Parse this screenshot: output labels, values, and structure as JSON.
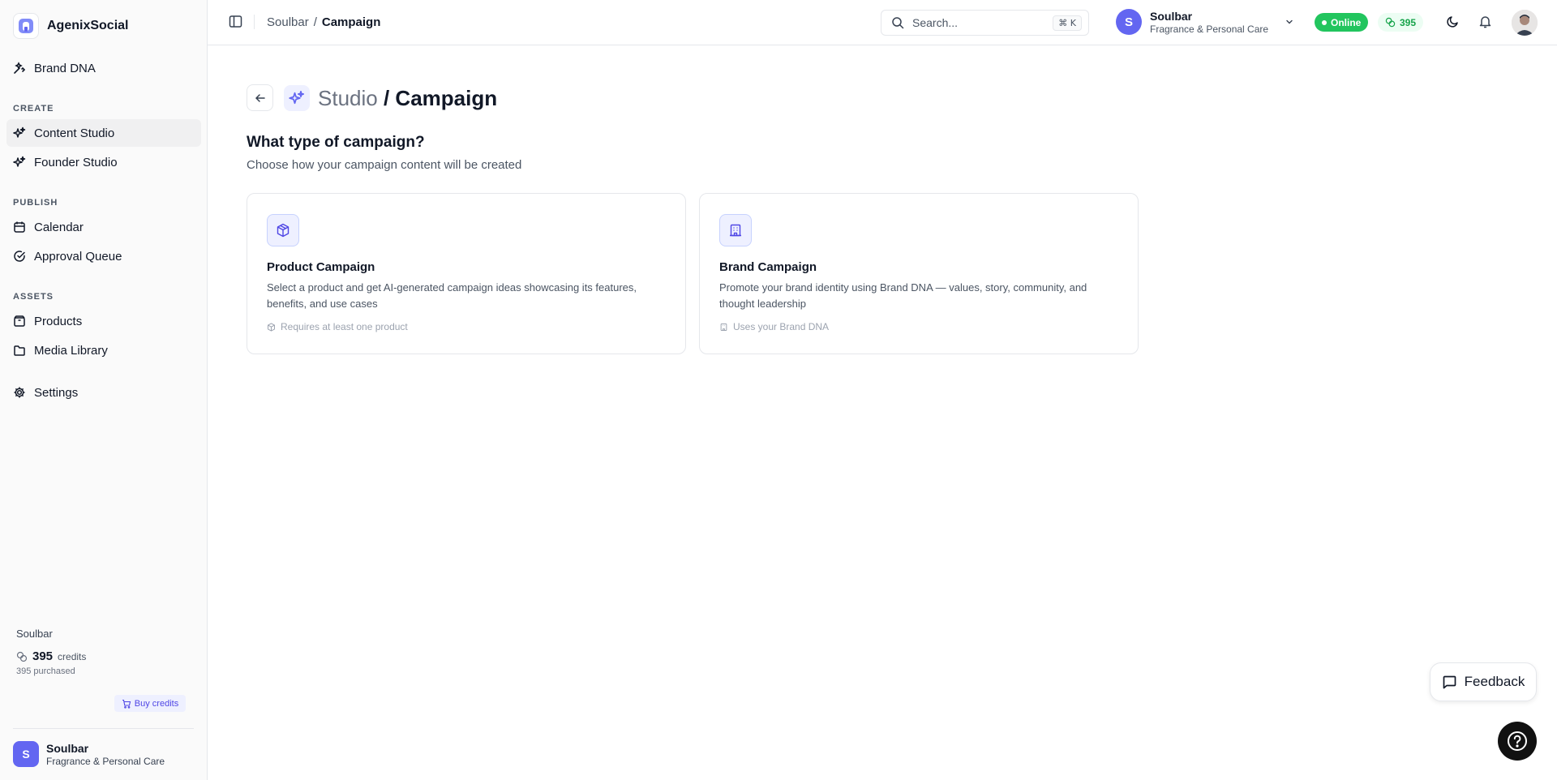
{
  "app": {
    "name": "AgenixSocial"
  },
  "sidebar": {
    "top_item": {
      "label": "Brand DNA",
      "icon": "brand-dna-icon"
    },
    "sections": [
      {
        "label": "CREATE",
        "items": [
          {
            "label": "Content Studio",
            "icon": "sparkles-icon",
            "active": true
          },
          {
            "label": "Founder Studio",
            "icon": "sparkles-icon"
          }
        ]
      },
      {
        "label": "PUBLISH",
        "items": [
          {
            "label": "Calendar",
            "icon": "calendar-icon"
          },
          {
            "label": "Approval Queue",
            "icon": "check-circle-icon"
          }
        ]
      },
      {
        "label": "ASSETS",
        "items": [
          {
            "label": "Products",
            "icon": "package-icon"
          },
          {
            "label": "Media Library",
            "icon": "folder-icon"
          }
        ]
      }
    ],
    "settings": {
      "label": "Settings",
      "icon": "gear-icon"
    },
    "credits": {
      "org": "Soulbar",
      "amount": "395",
      "unit": "credits",
      "purchased": "395 purchased",
      "buy_label": "Buy credits"
    },
    "org": {
      "initial": "S",
      "name": "Soulbar",
      "category": "Fragrance & Personal Care"
    }
  },
  "header": {
    "breadcrumb": [
      "Soulbar",
      "/",
      "Campaign"
    ],
    "search": {
      "placeholder": "Search...",
      "shortcut": "⌘ K"
    },
    "org": {
      "initial": "S",
      "name": "Soulbar",
      "category": "Fragrance & Personal Care"
    },
    "status": "Online",
    "credits": "395"
  },
  "main": {
    "title_prefix": "Studio",
    "title_main": "/ Campaign",
    "question": "What type of campaign?",
    "subtitle": "Choose how your campaign content will be created",
    "cards": [
      {
        "title": "Product Campaign",
        "description": "Select a product and get AI-generated campaign ideas showcasing its features, benefits, and use cases",
        "footnote": "Requires at least one product",
        "icon": "package-icon"
      },
      {
        "title": "Brand Campaign",
        "description": "Promote your brand identity using Brand DNA — values, story, community, and thought leadership",
        "footnote": "Uses your Brand DNA",
        "icon": "building-icon"
      }
    ]
  },
  "feedback_label": "Feedback",
  "colors": {
    "accent": "#6366f1",
    "online": "#22c55e",
    "credits_text": "#16a34a"
  }
}
